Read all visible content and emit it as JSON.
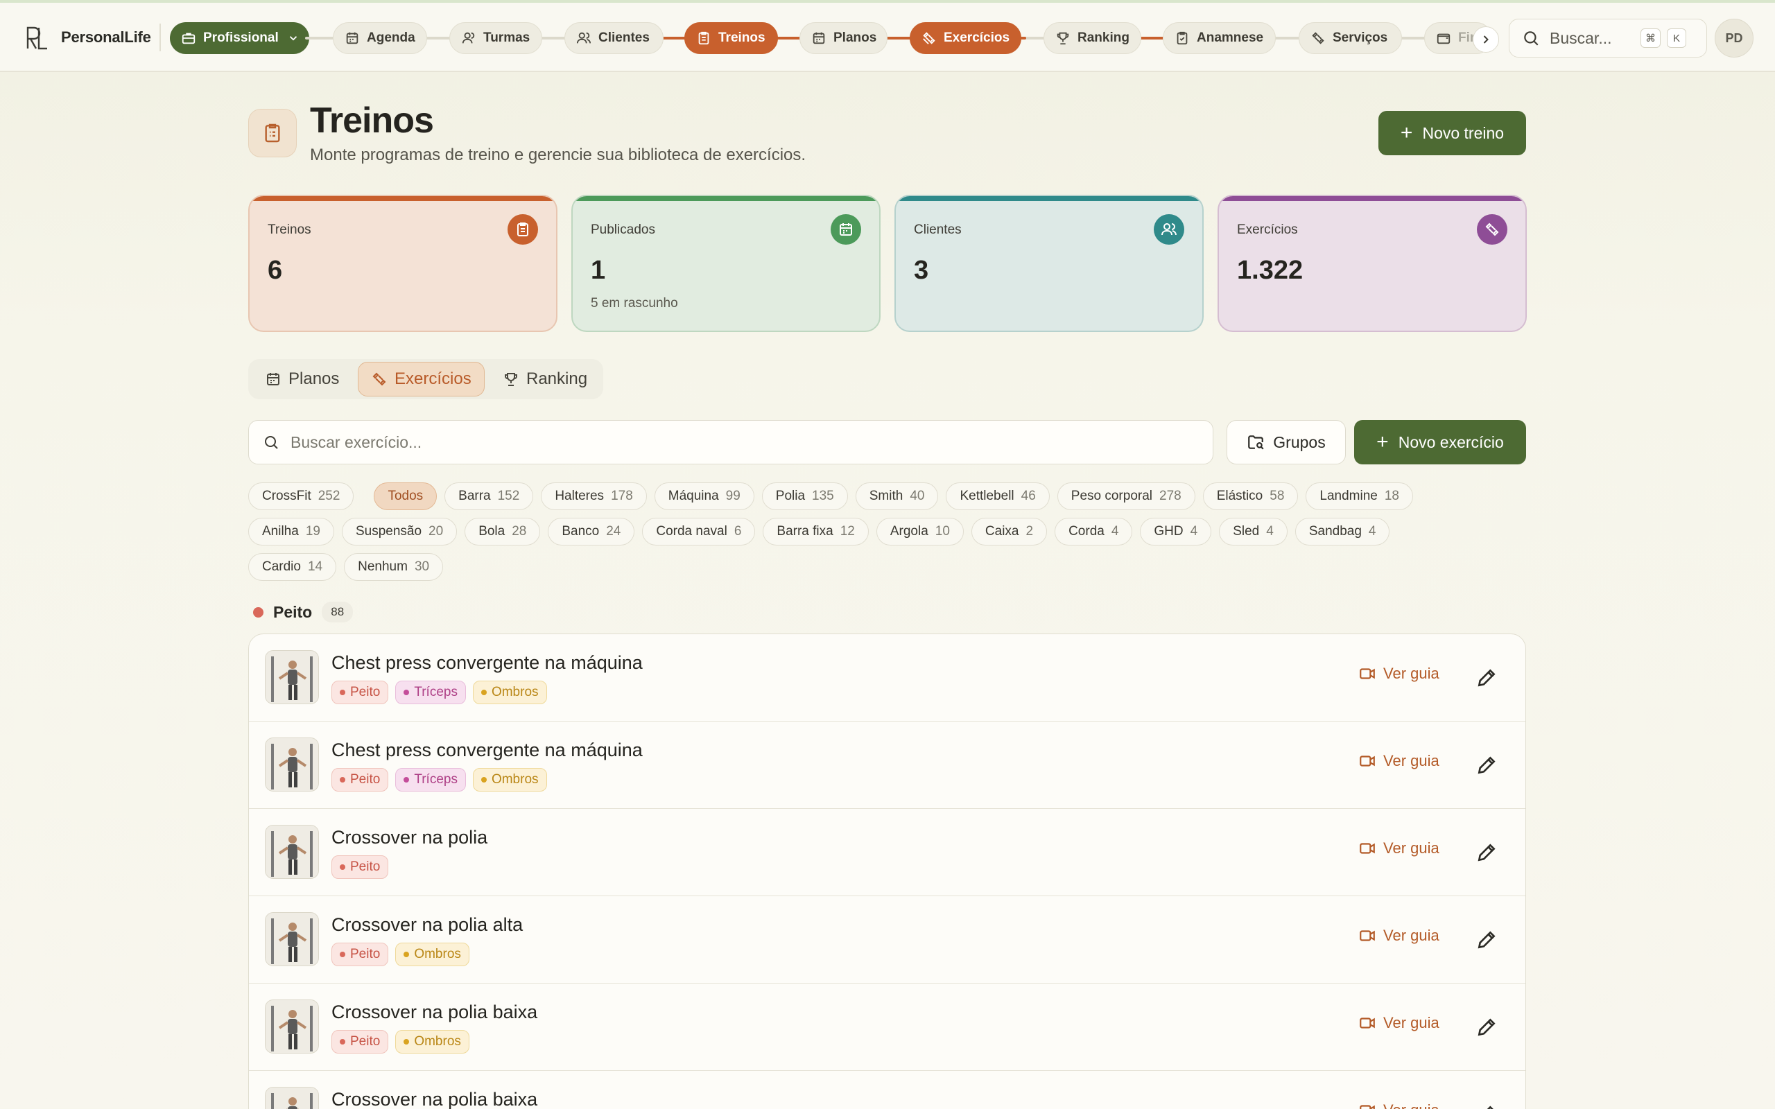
{
  "app": {
    "name": "PersonalLife",
    "workspace": "Profissional"
  },
  "nav": [
    {
      "label": "Agenda",
      "icon": "calendar-icon",
      "active": false
    },
    {
      "label": "Turmas",
      "icon": "users-icon",
      "active": false
    },
    {
      "label": "Clientes",
      "icon": "users-icon",
      "active": false
    },
    {
      "label": "Treinos",
      "icon": "clipboard-icon",
      "active": true
    },
    {
      "label": "Planos",
      "icon": "calendar-icon",
      "active": false
    },
    {
      "label": "Exercícios",
      "icon": "dumbbell-icon",
      "active": true
    },
    {
      "label": "Ranking",
      "icon": "trophy-icon",
      "active": false
    },
    {
      "label": "Anamnese",
      "icon": "clipboard-check-icon",
      "active": false
    },
    {
      "label": "Serviços",
      "icon": "dumbbell-icon",
      "active": false
    },
    {
      "label": "Fin",
      "icon": "wallet-icon",
      "active": false
    }
  ],
  "search": {
    "placeholder": "Buscar...",
    "shortcut_mod": "⌘",
    "shortcut_key": "K"
  },
  "user": {
    "initials": "PD"
  },
  "header": {
    "title": "Treinos",
    "subtitle": "Monte programas de treino e gerencie sua biblioteca de exercícios.",
    "new_button": "Novo treino"
  },
  "stats": [
    {
      "label": "Treinos",
      "value": "6",
      "note": "",
      "color": "#c8602d",
      "bg": "#f4e2d6",
      "border": "#e8c6b1",
      "icon": "clipboard-icon"
    },
    {
      "label": "Publicados",
      "value": "1",
      "note": "5 em rascunho",
      "color": "#4c9a5a",
      "bg": "#e1ece0",
      "border": "#bed7c0",
      "icon": "calendar-icon"
    },
    {
      "label": "Clientes",
      "value": "3",
      "note": "",
      "color": "#2f8a8a",
      "bg": "#dde9e6",
      "border": "#b6d1cd",
      "icon": "users-icon"
    },
    {
      "label": "Exercícios",
      "value": "1.322",
      "note": "",
      "color": "#8e4d96",
      "bg": "#ebdfe8",
      "border": "#d5bdd1",
      "icon": "dumbbell-icon"
    }
  ],
  "tabs": [
    {
      "label": "Planos",
      "icon": "calendar-icon",
      "active": false
    },
    {
      "label": "Exercícios",
      "icon": "dumbbell-icon",
      "active": true
    },
    {
      "label": "Ranking",
      "icon": "trophy-icon",
      "active": false
    }
  ],
  "exercise_search": {
    "placeholder": "Buscar exercício..."
  },
  "groups_button": "Grupos",
  "new_exercise_button": "Novo exercício",
  "equipment_filters": {
    "row1": [
      {
        "label": "CrossFit",
        "count": "252"
      },
      {
        "label": "Todos",
        "count": "",
        "active": true
      },
      {
        "label": "Barra",
        "count": "152"
      },
      {
        "label": "Halteres",
        "count": "178"
      },
      {
        "label": "Máquina",
        "count": "99"
      },
      {
        "label": "Polia",
        "count": "135"
      },
      {
        "label": "Smith",
        "count": "40"
      },
      {
        "label": "Kettlebell",
        "count": "46"
      },
      {
        "label": "Peso corporal",
        "count": "278"
      },
      {
        "label": "Elástico",
        "count": "58"
      },
      {
        "label": "Landmine",
        "count": "18"
      }
    ],
    "row2": [
      {
        "label": "Anilha",
        "count": "19"
      },
      {
        "label": "Suspensão",
        "count": "20"
      },
      {
        "label": "Bola",
        "count": "28"
      },
      {
        "label": "Banco",
        "count": "24"
      },
      {
        "label": "Corda naval",
        "count": "6"
      },
      {
        "label": "Barra fixa",
        "count": "12"
      },
      {
        "label": "Argola",
        "count": "10"
      },
      {
        "label": "Caixa",
        "count": "2"
      },
      {
        "label": "Corda",
        "count": "4"
      },
      {
        "label": "GHD",
        "count": "4"
      },
      {
        "label": "Sled",
        "count": "4"
      },
      {
        "label": "Sandbag",
        "count": "4"
      }
    ],
    "row3": [
      {
        "label": "Cardio",
        "count": "14"
      },
      {
        "label": "Nenhum",
        "count": "30"
      }
    ]
  },
  "group": {
    "name": "Peito",
    "count": "88",
    "color": "#d9685a"
  },
  "exercises": [
    {
      "name": "Chest press convergente na máquina",
      "tags": [
        "Peito",
        "Tríceps",
        "Ombros"
      ],
      "guide": "Ver guia"
    },
    {
      "name": "Chest press convergente na máquina",
      "tags": [
        "Peito",
        "Tríceps",
        "Ombros"
      ],
      "guide": "Ver guia"
    },
    {
      "name": "Crossover na polia",
      "tags": [
        "Peito"
      ],
      "guide": "Ver guia"
    },
    {
      "name": "Crossover na polia alta",
      "tags": [
        "Peito",
        "Ombros"
      ],
      "guide": "Ver guia"
    },
    {
      "name": "Crossover na polia baixa",
      "tags": [
        "Peito",
        "Ombros"
      ],
      "guide": "Ver guia"
    },
    {
      "name": "Crossover na polia baixa",
      "tags": [],
      "guide": "Ver guia"
    }
  ]
}
